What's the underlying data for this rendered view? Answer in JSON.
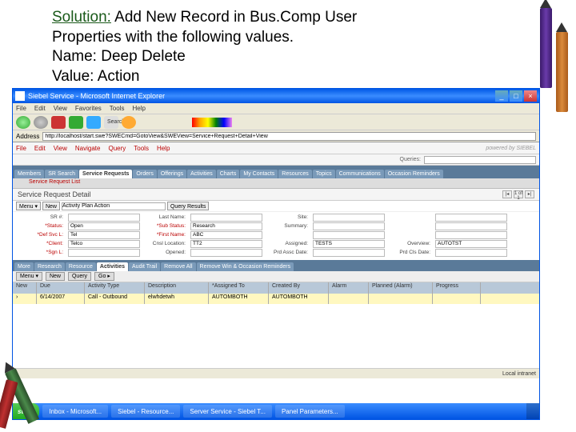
{
  "header": {
    "solution_label": "Solution:",
    "line1_rest": " Add New Record in Bus.Comp User",
    "line2": "Properties with the following values.",
    "line3": "Name: Deep Delete",
    "line4": "Value: Action"
  },
  "browser": {
    "title": "Siebel Service - Microsoft Internet Explorer",
    "menu": [
      "File",
      "Edit",
      "View",
      "Favorites",
      "Tools",
      "Help"
    ],
    "search_label": "Search",
    "address_label": "Address",
    "url": "http://localhost/start.swe?SWECmd=GotoView&SWEView=Service+Request+Detail+View"
  },
  "siebel": {
    "menu": [
      "File",
      "Edit",
      "View",
      "Navigate",
      "Query",
      "Tools",
      "Help"
    ],
    "brand": "powered by SIEBEL",
    "queries_label": "Queries:",
    "tabs": [
      "Members",
      "SR Search",
      "Service Requests",
      "Orders",
      "Offerings",
      "Activities",
      "Charts",
      "My Contacts",
      "Resources",
      "Topics",
      "Communications",
      "Occasion Reminders"
    ],
    "active_tab": 2,
    "sub_header": "Service Request List",
    "section": "Service Request Detail",
    "nav_count": "1 of 1",
    "actions": {
      "menu": "Menu ▾",
      "new": "New",
      "query_results": "Query Results"
    },
    "form_main_value": "Activity Plan Action"
  },
  "detail": {
    "rows": [
      {
        "l1": "SR #:",
        "v1": "",
        "l2": "Last Name:",
        "v2": "",
        "l3": "Site:",
        "v3": "",
        "l4": "",
        "v4": ""
      },
      {
        "l1": "*Status:",
        "v1": "Open",
        "l2": "*Sub Status:",
        "v2": "Research",
        "l3": "Summary:",
        "v3": "",
        "l4": "",
        "v4": ""
      },
      {
        "l1": "*Def Svc L:",
        "v1": "Tel",
        "l2": "*First Name:",
        "v2": "ABC",
        "l3": "",
        "v3": "",
        "l4": "",
        "v4": ""
      },
      {
        "l1": "*Client:",
        "v1": "Telco",
        "l2": "Cnsl Location:",
        "v2": "TT2",
        "l3": "Assigned:",
        "v3": "TESTS",
        "l4": "Overview:",
        "v4": "AUTOTST"
      },
      {
        "l1": "*Sgn L:",
        "v1": "",
        "l2": "Opened:",
        "v2": "",
        "l3": "Prd Assc Date:",
        "v3": "",
        "l4": "Prd Cls Date:",
        "v4": ""
      }
    ]
  },
  "subtabs": [
    "More",
    "Research",
    "Resource",
    "Activities",
    "Audit Trail",
    "Remove All",
    "Remove Win & Occasion Reminders"
  ],
  "subtab_active": 3,
  "actions2": {
    "menu": "Menu ▾",
    "new": "New",
    "query": "Query",
    "go": "Go ▸"
  },
  "table": {
    "cols": [
      "New",
      "Due",
      "Activity Type",
      "Description",
      "*Assigned To",
      "Created By",
      "Alarm",
      "Planned (Alarm)",
      "Progress"
    ],
    "row": {
      "due": "6/14/2007",
      "type": "Call - Outbound",
      "desc": "elwhdetwh",
      "assigned": "AUTOMBOTH",
      "created": "AUTOMBOTH"
    }
  },
  "status": {
    "left": "",
    "zone": "Local intranet"
  },
  "taskbar": {
    "start": "start",
    "items": [
      "Inbox - Microsoft...",
      "Siebel - Resource...",
      "Server Service - Siebel T...",
      "Panel Parameters..."
    ]
  }
}
